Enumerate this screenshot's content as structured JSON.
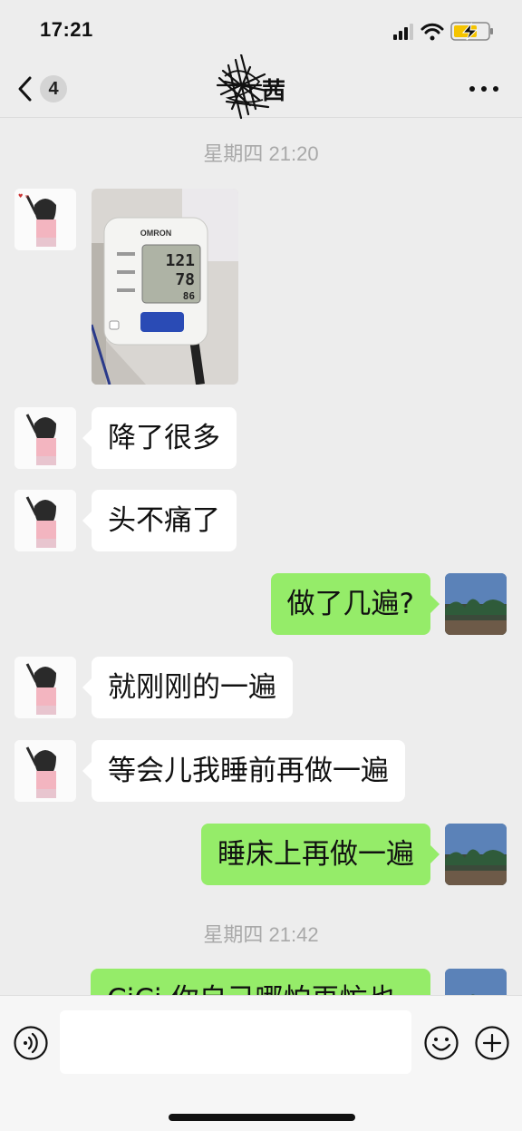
{
  "status_bar": {
    "time": "17:21"
  },
  "header": {
    "back_count": "4",
    "title": "茜"
  },
  "messages": [
    {
      "type": "timestamp",
      "text": "星期四 21:20"
    },
    {
      "type": "image",
      "side": "left",
      "content": "blood-pressure-monitor-photo",
      "screen": {
        "brand": "OMRON",
        "systolic": "121",
        "diastolic": "78",
        "pulse": "86"
      }
    },
    {
      "type": "text",
      "side": "left",
      "text": "降了很多"
    },
    {
      "type": "text",
      "side": "left",
      "text": "头不痛了"
    },
    {
      "type": "text",
      "side": "right",
      "text": "做了几遍?"
    },
    {
      "type": "text",
      "side": "left",
      "text": "就刚刚的一遍"
    },
    {
      "type": "text",
      "side": "left",
      "text": "等会儿我睡前再做一遍"
    },
    {
      "type": "text",
      "side": "right",
      "text": "睡床上再做一遍"
    },
    {
      "type": "timestamp",
      "text": "星期四 21:42"
    },
    {
      "type": "text",
      "side": "right",
      "text": "CiCi 你自己哪怕再忙也",
      "partially_hidden": true
    }
  ],
  "input_bar": {
    "value": "",
    "placeholder": ""
  },
  "colors": {
    "background": "#ededed",
    "bubble_out": "#95ec69",
    "bubble_in": "#ffffff",
    "timestamp": "#a9a9a9",
    "battery_charge": "#f5c400"
  },
  "icons": [
    "signal-icon",
    "wifi-icon",
    "battery-charging-icon",
    "back-chevron-icon",
    "more-icon",
    "voice-icon",
    "emoji-icon",
    "plus-icon"
  ]
}
